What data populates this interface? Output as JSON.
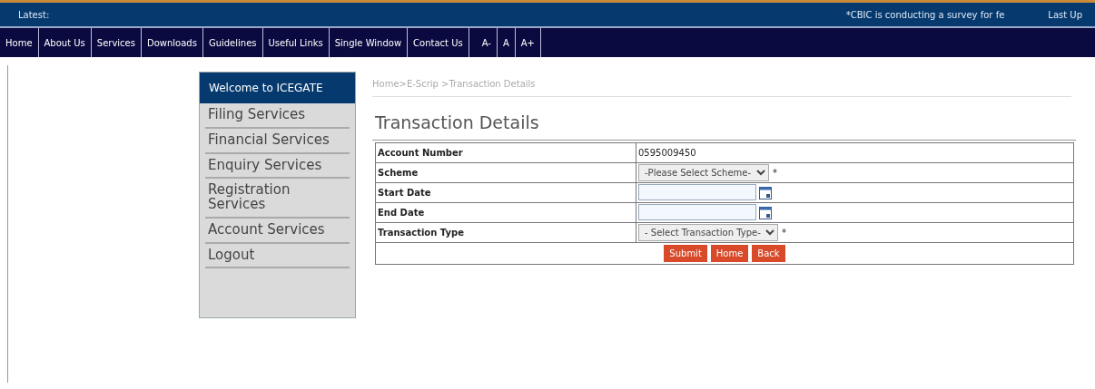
{
  "ticker": {
    "label": "Latest:",
    "message": "*CBIC is conducting a survey for fe",
    "updated": "Last Up"
  },
  "nav": [
    {
      "label": "Home"
    },
    {
      "label": "About Us"
    },
    {
      "label": "Services"
    },
    {
      "label": "Downloads"
    },
    {
      "label": "Guidelines"
    },
    {
      "label": "Useful Links"
    },
    {
      "label": "Single Window"
    },
    {
      "label": "Contact Us"
    }
  ],
  "font_size_controls": [
    "A-",
    "A",
    "A+"
  ],
  "sidebar": {
    "title": "Welcome to ICEGATE",
    "items": [
      {
        "label": "Filing Services"
      },
      {
        "label": "Financial Services"
      },
      {
        "label": "Enquiry Services"
      },
      {
        "label": "Registration Services"
      },
      {
        "label": "Account Services"
      },
      {
        "label": "Logout"
      }
    ]
  },
  "breadcrumb": "Home>E-Scrip >Transaction Details",
  "page_title": "Transaction Details",
  "form": [
    {
      "label": "Account Number",
      "kind": "text",
      "value": "0595009450"
    },
    {
      "label": "Scheme",
      "kind": "select",
      "value": "-Please Select Scheme-",
      "required_mark": "*"
    },
    {
      "label": "Start Date",
      "kind": "date"
    },
    {
      "label": "End Date",
      "kind": "date"
    },
    {
      "label": "Transaction Type",
      "kind": "select",
      "value": "- Select Transaction Type-",
      "required_mark": "*"
    }
  ],
  "buttons": [
    "Submit",
    "Home",
    "Back"
  ]
}
